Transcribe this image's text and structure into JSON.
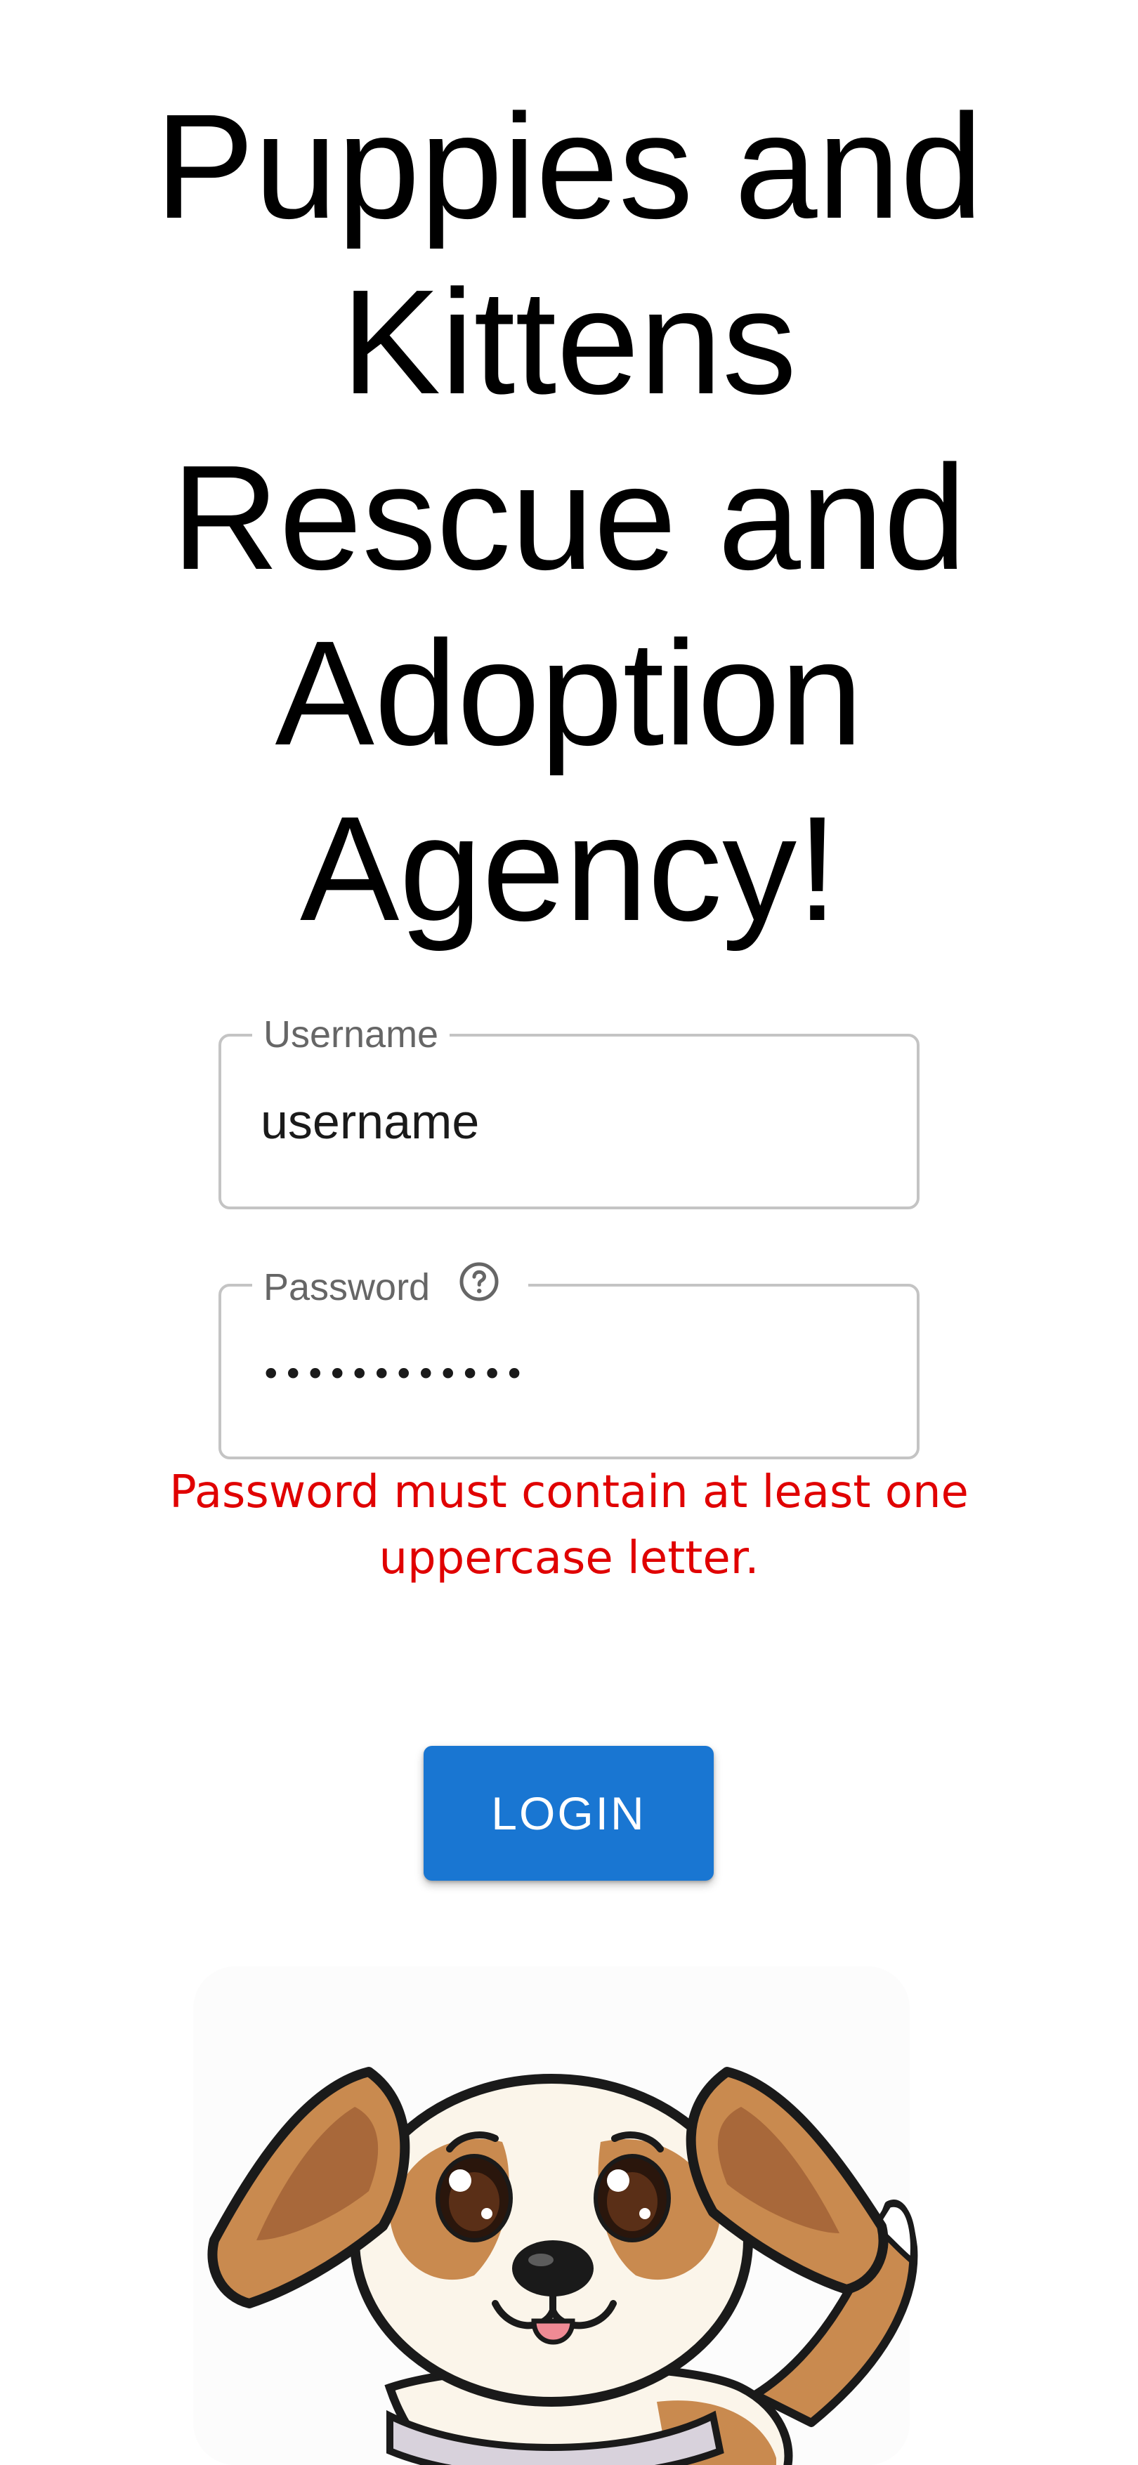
{
  "header": {
    "title": "Puppies and\nKittens\nRescue and\nAdoption\nAgency!"
  },
  "form": {
    "username": {
      "label": "Username",
      "value": "username"
    },
    "password": {
      "label": "Password",
      "value": "••••••••••••",
      "help_icon": "help-circle-icon"
    },
    "error_message": "Password must contain at least one uppercase letter.",
    "login_label": "LOGIN"
  },
  "illustration": {
    "icon": "puppy-illustration"
  },
  "colors": {
    "primary": "#1976d2",
    "error": "#e00000",
    "border": "#c4c4c4",
    "label": "#666666"
  }
}
